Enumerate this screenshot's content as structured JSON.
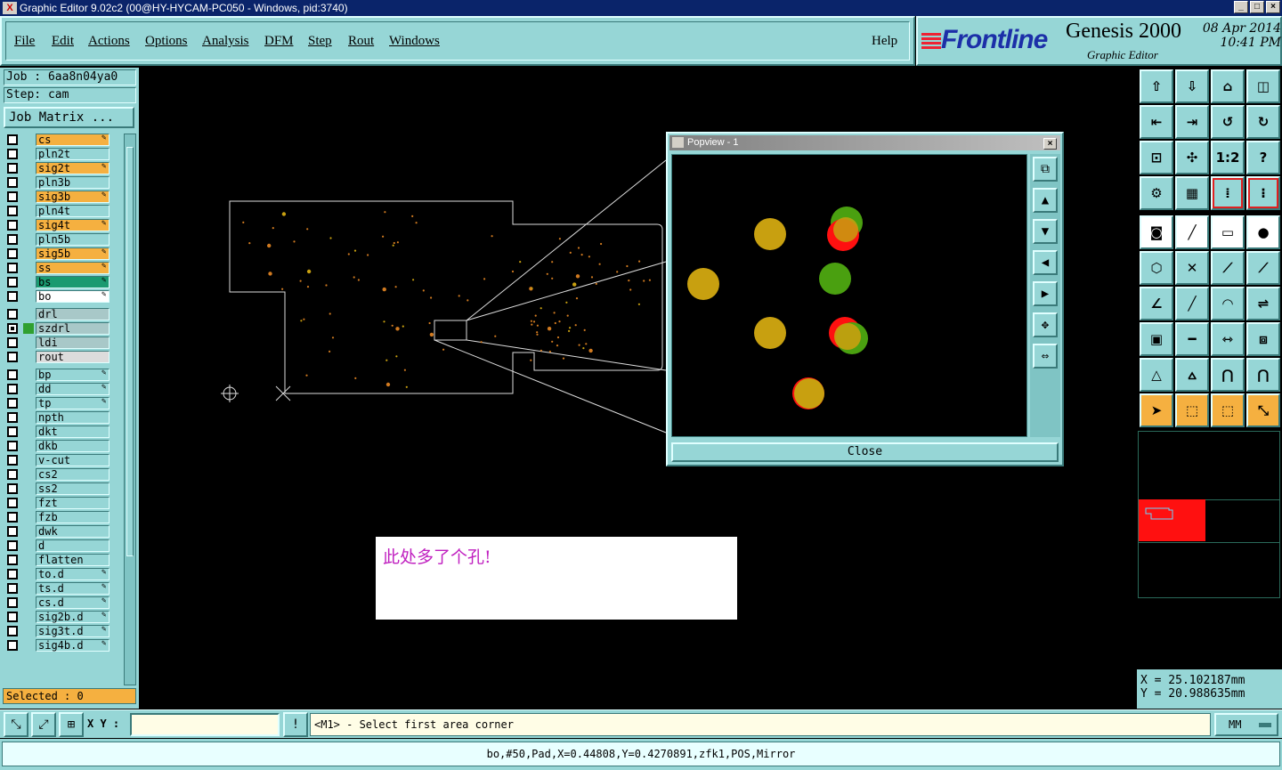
{
  "window": {
    "title": "Graphic Editor 9.02c2 (00@HY-HYCAM-PC050 - Windows, pid:3740)",
    "app_icon": "X",
    "minimize": "_",
    "maximize": "□",
    "close": "×"
  },
  "menu": {
    "file": "File",
    "edit": "Edit",
    "actions": "Actions",
    "options": "Options",
    "analysis": "Analysis",
    "dfm": "DFM",
    "step": "Step",
    "rout": "Rout",
    "windows": "Windows",
    "help": "Help"
  },
  "brand": {
    "logo": "Frontline",
    "product": "Genesis 2000",
    "subtitle": "Graphic Editor",
    "date": "08 Apr 2014",
    "time": "10:41 PM"
  },
  "job": {
    "job_label": "Job : 6aa8n04ya0",
    "step_label": "Step: cam",
    "matrix_button": "Job Matrix ..."
  },
  "layers": [
    {
      "name": "cs",
      "color": "#f5b040",
      "checked": false,
      "editable": true
    },
    {
      "name": "pln2t",
      "color": "#96d6d6",
      "checked": false,
      "editable": false
    },
    {
      "name": "sig2t",
      "color": "#f5b040",
      "checked": false,
      "editable": true
    },
    {
      "name": "pln3b",
      "color": "#96d6d6",
      "checked": false,
      "editable": false
    },
    {
      "name": "sig3b",
      "color": "#f5b040",
      "checked": false,
      "editable": true
    },
    {
      "name": "pln4t",
      "color": "#96d6d6",
      "checked": false,
      "editable": false
    },
    {
      "name": "sig4t",
      "color": "#f5b040",
      "checked": false,
      "editable": true
    },
    {
      "name": "pln5b",
      "color": "#96d6d6",
      "checked": false,
      "editable": false
    },
    {
      "name": "sig5b",
      "color": "#f5b040",
      "checked": false,
      "editable": true
    },
    {
      "name": "ss",
      "color": "#f5b040",
      "checked": false,
      "editable": true
    },
    {
      "name": "bs",
      "color": "#1a9a70",
      "checked": false,
      "editable": true
    },
    {
      "name": "bo",
      "color": "#ffffff",
      "checked": false,
      "editable": true
    },
    {
      "name": "drl",
      "color": "#a8c8c8",
      "checked": false,
      "editable": false
    },
    {
      "name": "szdrl",
      "color": "#a8c8c8",
      "checked": true,
      "editable": false
    },
    {
      "name": "ldi",
      "color": "#a8c8c8",
      "checked": false,
      "editable": false
    },
    {
      "name": "rout",
      "color": "#dcdcdc",
      "checked": false,
      "editable": false
    },
    {
      "name": "bp",
      "color": "#96d6d6",
      "checked": false,
      "editable": true
    },
    {
      "name": "dd",
      "color": "#96d6d6",
      "checked": false,
      "editable": true
    },
    {
      "name": "tp",
      "color": "#96d6d6",
      "checked": false,
      "editable": true
    },
    {
      "name": "npth",
      "color": "#96d6d6",
      "checked": false,
      "editable": false
    },
    {
      "name": "dkt",
      "color": "#96d6d6",
      "checked": false,
      "editable": false
    },
    {
      "name": "dkb",
      "color": "#96d6d6",
      "checked": false,
      "editable": false
    },
    {
      "name": "v-cut",
      "color": "#96d6d6",
      "checked": false,
      "editable": false
    },
    {
      "name": "cs2",
      "color": "#96d6d6",
      "checked": false,
      "editable": false
    },
    {
      "name": "ss2",
      "color": "#96d6d6",
      "checked": false,
      "editable": false
    },
    {
      "name": "fzt",
      "color": "#96d6d6",
      "checked": false,
      "editable": false
    },
    {
      "name": "fzb",
      "color": "#96d6d6",
      "checked": false,
      "editable": false
    },
    {
      "name": "dwk",
      "color": "#96d6d6",
      "checked": false,
      "editable": false
    },
    {
      "name": "d",
      "color": "#96d6d6",
      "checked": false,
      "editable": false
    },
    {
      "name": "flatten",
      "color": "#96d6d6",
      "checked": false,
      "editable": false
    },
    {
      "name": "to.d",
      "color": "#96d6d6",
      "checked": false,
      "editable": true
    },
    {
      "name": "ts.d",
      "color": "#96d6d6",
      "checked": false,
      "editable": true
    },
    {
      "name": "cs.d",
      "color": "#96d6d6",
      "checked": false,
      "editable": true
    },
    {
      "name": "sig2b.d",
      "color": "#96d6d6",
      "checked": false,
      "editable": true
    },
    {
      "name": "sig3t.d",
      "color": "#96d6d6",
      "checked": false,
      "editable": true
    },
    {
      "name": "sig4b.d",
      "color": "#96d6d6",
      "checked": false,
      "editable": true
    }
  ],
  "selected": "Selected : 0",
  "popview": {
    "title": "Popview - 1",
    "close_button": "Close"
  },
  "note": "此处多了个孔!",
  "coords": {
    "x": "X  = 25.102187mm",
    "y": "Y  = 20.988635mm"
  },
  "bottom": {
    "xy_label": "X Y :",
    "prompt": "<M1> - Select first area corner",
    "units": "MM",
    "status": "bo,#50,Pad,X=0.44808,Y=0.4270891,zfk1,POS,Mirror"
  },
  "colors": {
    "panel": "#96d6d6",
    "pad_yellow": "#c8a010",
    "pad_green": "#4aa010",
    "pad_red": "#ff1010"
  }
}
